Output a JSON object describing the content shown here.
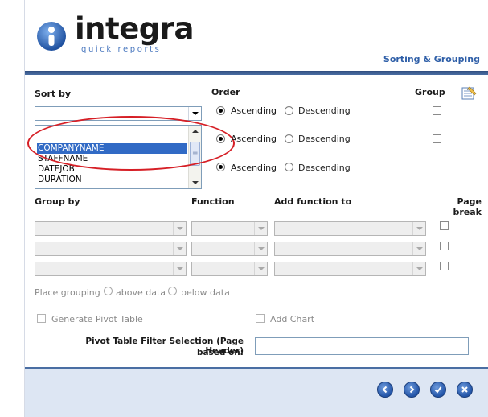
{
  "header": {
    "logo_text": "integra",
    "logo_subtext": "quick reports",
    "section_title": "Sorting & Grouping"
  },
  "sort": {
    "sort_by_label": "Sort by",
    "order_label": "Order",
    "group_label": "Group",
    "rows": [
      {
        "ascending": "Ascending",
        "descending": "Descending",
        "selected": "Ascending"
      },
      {
        "ascending": "Ascending",
        "descending": "Descending",
        "selected": "Ascending"
      },
      {
        "ascending": "Ascending",
        "descending": "Descending",
        "selected": "Ascending"
      }
    ],
    "dropdown_items": [
      "COMPANYNAME",
      "STAFFNAME",
      "DATEJOB",
      "DURATION"
    ],
    "dropdown_selected": "COMPANYNAME"
  },
  "grouping": {
    "group_by_label": "Group by",
    "function_label": "Function",
    "add_function_label": "Add function to",
    "page_break_label": "Page\nbreak",
    "place_grouping_label": "Place grouping",
    "above_data": "above data",
    "below_data": "below data"
  },
  "pivot": {
    "generate_label": "Generate Pivot Table",
    "add_chart_label": "Add Chart",
    "filter_label_line1": "Pivot Table Filter Selection (Page Header)",
    "filter_label_line2": "based on:",
    "filter_value": ""
  },
  "footer": {
    "buttons": [
      "previous",
      "next",
      "ok",
      "cancel"
    ]
  },
  "colors": {
    "brand_blue": "#2f5fa8",
    "selection": "#316ac5",
    "highlight": "#d61f26",
    "footer_bg": "#dde6f3"
  }
}
